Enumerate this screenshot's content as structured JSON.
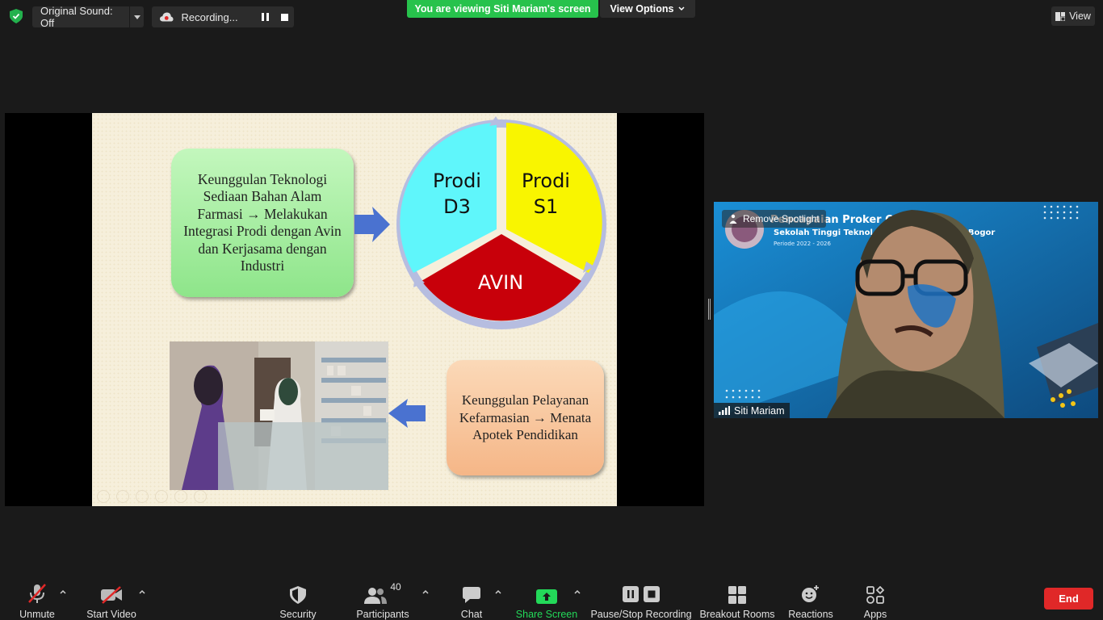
{
  "top_bar": {
    "sound_label": "Original Sound: Off",
    "recording_label": "Recording...",
    "viewing_banner": "You are viewing Siti Mariam's screen",
    "view_options_label": "View Options",
    "view_label": "View"
  },
  "slide": {
    "green_box_text": "Keunggulan Teknologi Sediaan Bahan Alam Farmasi → Melakukan Integrasi Prodi dengan Avin dan Kerjasama dengan Industri",
    "peach_box_text": "Keunggulan Pelayanan Kefarmasian → Menata Apotek Pendidikan",
    "segment_d3": [
      "Prodi",
      "D3"
    ],
    "segment_s1": [
      "Prodi",
      "S1"
    ],
    "segment_avin": "AVIN",
    "colors": {
      "d3": "#5ff6fb",
      "s1": "#f9f500",
      "avin": "#c8000a",
      "ring": "#b6bde0",
      "arrow": "#4a72d0"
    }
  },
  "video": {
    "remove_spotlight_label": "Remove Spotlight",
    "participant_name": "Siti Mariam",
    "bg_line1": "Pencapaian Proker C",
    "bg_line2": "Sekolah Tinggi Teknol",
    "bg_line2b": "si Bogor",
    "bg_line3": "Periode 2022 - 2026"
  },
  "toolbar": {
    "unmute": "Unmute",
    "start_video": "Start Video",
    "security": "Security",
    "participants": "Participants",
    "participants_count": "40",
    "chat": "Chat",
    "share_screen": "Share Screen",
    "pause_stop": "Pause/Stop Recording",
    "breakout": "Breakout Rooms",
    "reactions": "Reactions",
    "apps": "Apps",
    "end": "End"
  }
}
